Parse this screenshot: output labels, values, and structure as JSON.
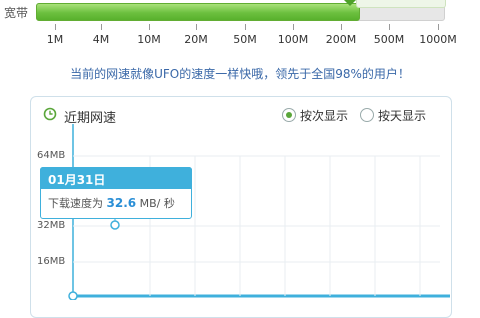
{
  "speed_bar": {
    "label": "宽带",
    "fill_fraction": 0.79,
    "ticks": [
      "1M",
      "4M",
      "10M",
      "20M",
      "50M",
      "100M",
      "200M",
      "500M",
      "1000M"
    ]
  },
  "slogan": "当前的网速就像UFO的速度一样快哦，领先于全国98%的用户！",
  "panel": {
    "title": "近期网速",
    "options": [
      {
        "label": "按次显示",
        "selected": true
      },
      {
        "label": "按天显示",
        "selected": false
      }
    ],
    "y_labels": [
      "64MB",
      "32MB",
      "16MB"
    ]
  },
  "tooltip": {
    "date": "01月31日",
    "prefix": "下载速度为",
    "value": "32.6",
    "unit": "MB/ 秒"
  },
  "colors": {
    "accent_green": "#5aa63a",
    "tooltip_blue": "#3fb0dc",
    "slogan_blue": "#3a68a8"
  }
}
